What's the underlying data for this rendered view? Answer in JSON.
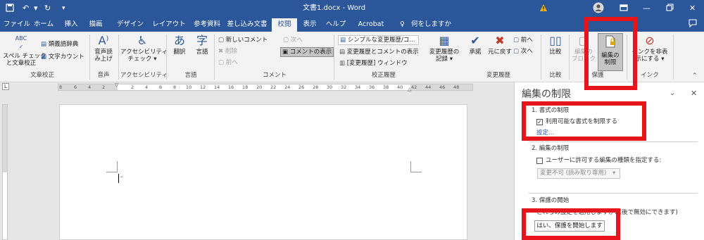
{
  "title_bar": {
    "title": "文書1.docx  -  Word",
    "warning_icon": "warning-icon",
    "account_icon": "account-icon",
    "ribbon_display_icon": "ribbon-display-options-icon",
    "minimize_icon": "minimize-icon",
    "restore_icon": "restore-icon",
    "close_icon": "close-icon",
    "save_icon": "save-icon",
    "undo_icon": "undo-icon",
    "redo_icon": "redo-icon",
    "customize_icon": "customize-qat-icon"
  },
  "tabs": [
    "ファイル",
    "ホーム",
    "挿入",
    "描画",
    "デザイン",
    "レイアウト",
    "参考資料",
    "差し込み文書",
    "校閲",
    "表示",
    "ヘルプ",
    "Acrobat"
  ],
  "active_tab": "校閲",
  "tell_me": "何をしますか",
  "ribbon": {
    "spell_check": "スペル チェック",
    "spell_check2": "と文章校正",
    "thesaurus": "類義語辞典",
    "word_count": "文字カウント",
    "group_proofing": "文章校正",
    "read_aloud": "音声読",
    "read_aloud2": "み上げ",
    "group_speech": "音声",
    "accessibility": "アクセシビリティ",
    "accessibility2": "チェック ▾",
    "group_accessibility": "アクセシビリティ",
    "translate": "翻訳",
    "language": "言語",
    "group_language": "言語",
    "new_comment": "新しいコメント",
    "delete": "削除",
    "previous": "前へ",
    "next": "次へ",
    "show_comments": "コメントの表示",
    "group_comments": "コメント",
    "markup_select": "シンプルな変更履歴/コ...",
    "show_markup": "変更履歴とコメントの表示",
    "reviewing_pane": "[変更履歴] ウィンドウ",
    "track_changes": "変更履歴の",
    "track_changes2": "記録 ▾",
    "group_tracking": "校正履歴",
    "accept": "承諾",
    "reject": "元に戻す",
    "change_prev": "前へ",
    "change_next": "次へ",
    "group_changes": "変更履歴",
    "compare": "比較",
    "group_compare": "比較",
    "block_authors": "編集の",
    "block_authors2": "ブロック",
    "restrict_editing": "編集の",
    "restrict_editing2": "制限",
    "group_protect": "保護",
    "hide_ink": "インクを非表",
    "hide_ink2": "示にする ▾",
    "group_ink": "インク"
  },
  "ruler_numbers": [
    "8",
    "6",
    "4",
    "2",
    "2",
    "4",
    "6",
    "8",
    "10",
    "12",
    "14",
    "16",
    "18",
    "20",
    "22",
    "24",
    "26",
    "28",
    "30",
    "32",
    "34",
    "36",
    "38",
    "40",
    "42",
    "44",
    "46",
    "48"
  ],
  "pane": {
    "title": "編集の制限",
    "section1": "1. 書式の制限",
    "limit_formatting_label": "利用可能な書式を制限する",
    "limit_formatting_checked": true,
    "settings_link": "設定...",
    "section2": "2. 編集の制限",
    "allow_editing_label": "ユーザーに許可する編集の種類を指定する:",
    "allow_editing_checked": false,
    "editing_type": "変更不可 (読み取り専用)",
    "section3": "3. 保護の開始",
    "apply_text": "これらの設定を適用しますか? (後で無効にできます)",
    "start_button": "はい、保護を開始します"
  },
  "colors": {
    "titlebar": "#2b579a",
    "highlight": "#e8141c",
    "ribbon": "#f3f3f3"
  }
}
